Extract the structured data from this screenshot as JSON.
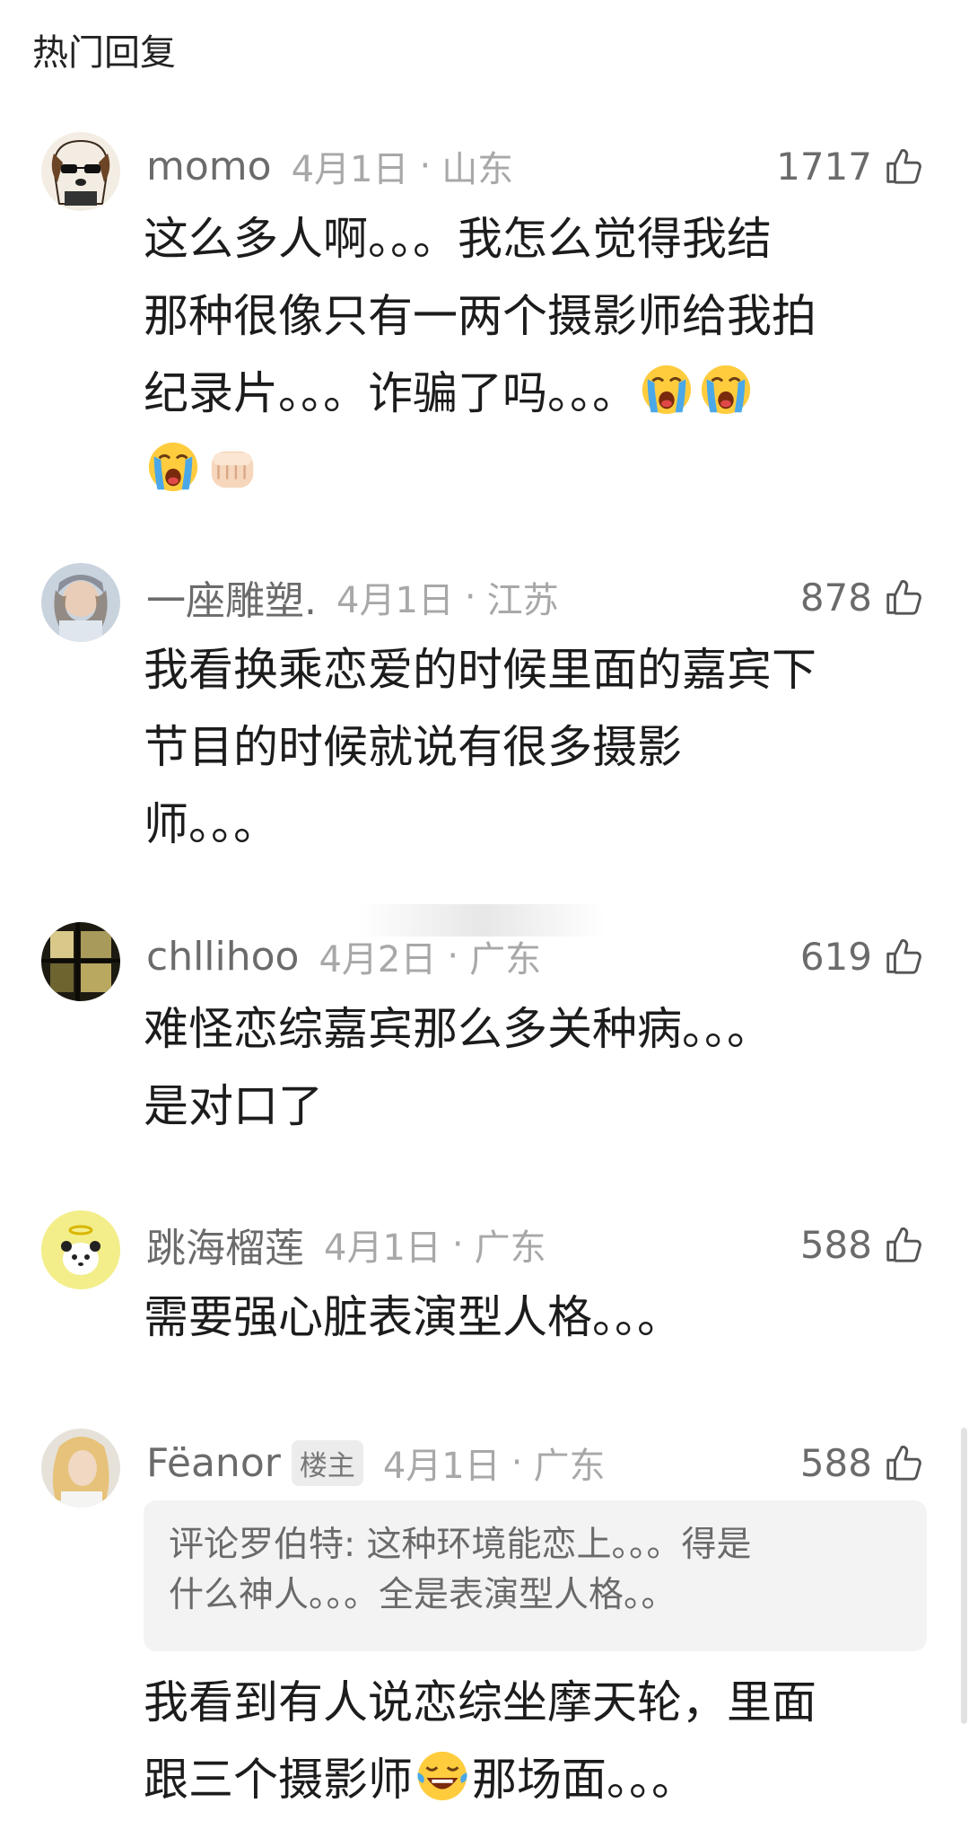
{
  "section_title": "热门回复",
  "comments": [
    {
      "username": "momo",
      "date": "4月1日",
      "location": "山东",
      "likes": "1717",
      "lines": [
        "这么多人啊。。。我怎么觉得我结",
        "那种很像只有一两个摄影师给我拍",
        "纪录片。。。诈骗了吗。。。"
      ],
      "emojis_line3": [
        "crying-emoji",
        "crying-emoji"
      ],
      "emojis_line4": [
        "crying-emoji",
        "fist-emoji"
      ]
    },
    {
      "username": "一座雕塑.",
      "date": "4月1日",
      "location": "江苏",
      "likes": "878",
      "lines": [
        "我看换乘恋爱的时候里面的嘉宾下",
        "节目的时候就说有很多摄影",
        "师。。。"
      ]
    },
    {
      "username": "chllihoo",
      "date": "4月2日",
      "location": "广东",
      "likes": "619",
      "lines": [
        "难怪恋综嘉宾那么多关种病。。。",
        "是对口了"
      ]
    },
    {
      "username": "跳海榴莲",
      "date": "4月1日",
      "location": "广东",
      "likes": "588",
      "lines": [
        "需要强心脏表演型人格。。。"
      ]
    },
    {
      "username": "Fëanor",
      "badge": "楼主",
      "date": "4月1日",
      "location": "广东",
      "likes": "588",
      "quote_lines": [
        "评论罗伯特: 这种环境能恋上。。。得是",
        "什么神人。。。全是表演型人格。。"
      ],
      "lines": [
        "我看到有人说恋综坐摩天轮，里面",
        "跟三个摄影师",
        "那场面。。。"
      ],
      "emoji_inline": "laughing-tears-emoji"
    }
  ],
  "icons": {
    "like": "thumbs-up-icon"
  },
  "colors": {
    "username": "#6b6b6b",
    "meta": "#a8a8a8",
    "quote_bg": "#f3f3f3"
  }
}
